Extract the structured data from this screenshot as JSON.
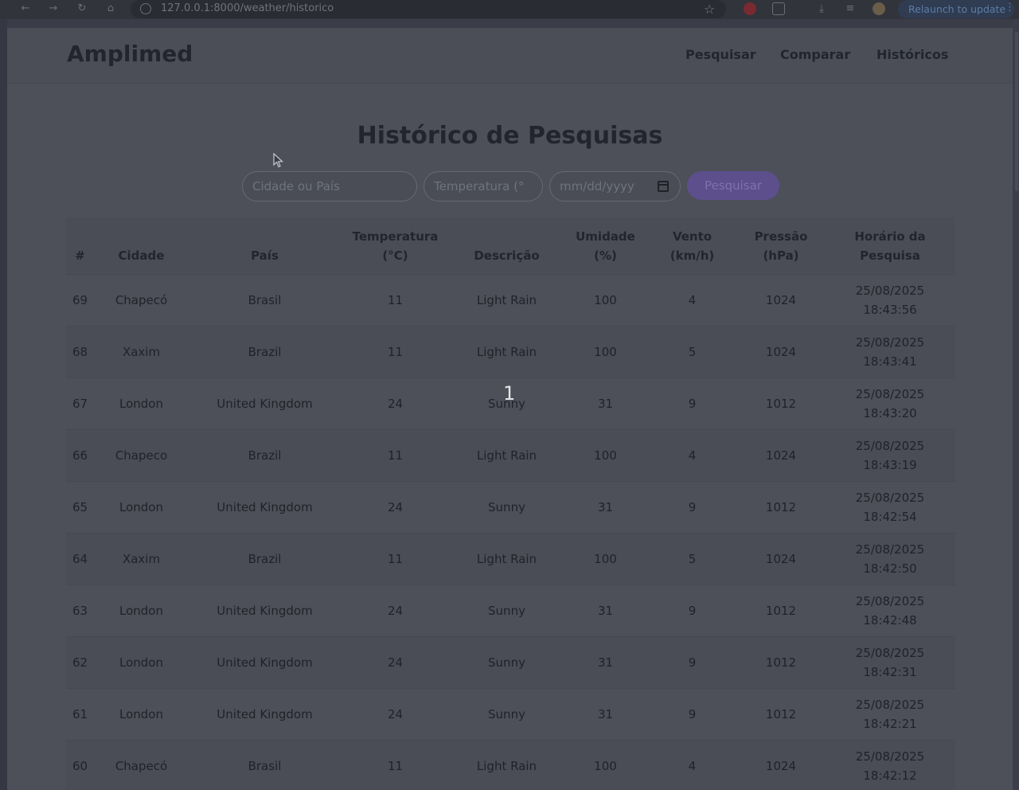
{
  "browser": {
    "url": "127.0.0.1:8000/weather/historico",
    "relaunch_label": "Relaunch to update"
  },
  "navbar": {
    "brand": "Amplimed",
    "links": [
      "Pesquisar",
      "Comparar",
      "Históricos"
    ]
  },
  "page_title": "Histórico de Pesquisas",
  "filters": {
    "city_placeholder": "Cidade ou País",
    "temp_placeholder": "Temperatura (°",
    "date_placeholder": "mm/dd/yyyy",
    "search_button": "Pesquisar"
  },
  "table": {
    "headers": {
      "id": "#",
      "city": "Cidade",
      "country": "País",
      "temp_line1": "Temperatura",
      "temp_line2": "(°C)",
      "desc": "Descrição",
      "humidity_line1": "Umidade",
      "humidity_line2": "(%)",
      "wind_line1": "Vento",
      "wind_line2": "(km/h)",
      "pressure_line1": "Pressão",
      "pressure_line2": "(hPa)",
      "time_line1": "Horário da",
      "time_line2": "Pesquisa"
    },
    "rows": [
      {
        "id": "69",
        "city": "Chapecó",
        "country": "Brasil",
        "temp": "11",
        "desc": "Light Rain",
        "humidity": "100",
        "wind": "4",
        "pressure": "1024",
        "date": "25/08/2025",
        "time": "18:43:56"
      },
      {
        "id": "68",
        "city": "Xaxim",
        "country": "Brazil",
        "temp": "11",
        "desc": "Light Rain",
        "humidity": "100",
        "wind": "5",
        "pressure": "1024",
        "date": "25/08/2025",
        "time": "18:43:41"
      },
      {
        "id": "67",
        "city": "London",
        "country": "United Kingdom",
        "temp": "24",
        "desc": "Sunny",
        "humidity": "31",
        "wind": "9",
        "pressure": "1012",
        "date": "25/08/2025",
        "time": "18:43:20"
      },
      {
        "id": "66",
        "city": "Chapeco",
        "country": "Brazil",
        "temp": "11",
        "desc": "Light Rain",
        "humidity": "100",
        "wind": "4",
        "pressure": "1024",
        "date": "25/08/2025",
        "time": "18:43:19"
      },
      {
        "id": "65",
        "city": "London",
        "country": "United Kingdom",
        "temp": "24",
        "desc": "Sunny",
        "humidity": "31",
        "wind": "9",
        "pressure": "1012",
        "date": "25/08/2025",
        "time": "18:42:54"
      },
      {
        "id": "64",
        "city": "Xaxim",
        "country": "Brazil",
        "temp": "11",
        "desc": "Light Rain",
        "humidity": "100",
        "wind": "5",
        "pressure": "1024",
        "date": "25/08/2025",
        "time": "18:42:50"
      },
      {
        "id": "63",
        "city": "London",
        "country": "United Kingdom",
        "temp": "24",
        "desc": "Sunny",
        "humidity": "31",
        "wind": "9",
        "pressure": "1012",
        "date": "25/08/2025",
        "time": "18:42:48"
      },
      {
        "id": "62",
        "city": "London",
        "country": "United Kingdom",
        "temp": "24",
        "desc": "Sunny",
        "humidity": "31",
        "wind": "9",
        "pressure": "1012",
        "date": "25/08/2025",
        "time": "18:42:31"
      },
      {
        "id": "61",
        "city": "London",
        "country": "United Kingdom",
        "temp": "24",
        "desc": "Sunny",
        "humidity": "31",
        "wind": "9",
        "pressure": "1012",
        "date": "25/08/2025",
        "time": "18:42:21"
      },
      {
        "id": "60",
        "city": "Chapecó",
        "country": "Brasil",
        "temp": "11",
        "desc": "Light Rain",
        "humidity": "100",
        "wind": "4",
        "pressure": "1024",
        "date": "25/08/2025",
        "time": "18:42:12"
      }
    ]
  },
  "overlay_number": "1"
}
